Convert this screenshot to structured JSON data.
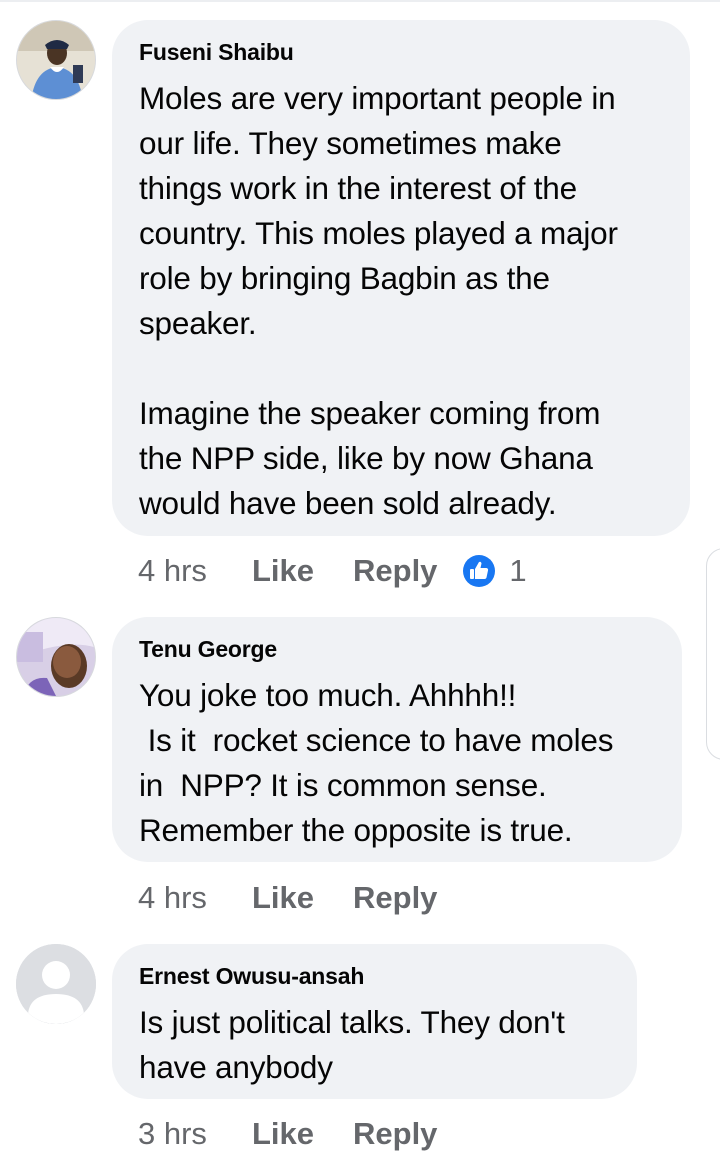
{
  "comments": [
    {
      "author": "Fuseni Shaibu",
      "text": "Moles are very important people in\nour life. They sometimes make\nthings work in the interest of the\ncountry. This moles played a major\nrole by bringing Bagbin as the\nspeaker.\n\nImagine the speaker coming from\nthe NPP side, like by now Ghana\nwould have been sold already.",
      "time": "4 hrs",
      "like": "Like",
      "reply": "Reply",
      "reaction_count": "1"
    },
    {
      "author": "Tenu George",
      "text": "You joke too much. Ahhhh!!\n Is it  rocket science to have moles\nin  NPP? It is common sense.\nRemember the opposite is true.",
      "time": "4 hrs",
      "like": "Like",
      "reply": "Reply"
    },
    {
      "author": "Ernest Owusu-ansah",
      "text": "Is just political talks. They don't\nhave anybody",
      "time": "3 hrs",
      "like": "Like",
      "reply": "Reply"
    }
  ],
  "colors": {
    "bubble": "#f0f2f5",
    "meta": "#65676b",
    "like_blue": "#1877f2"
  },
  "icons": [
    "like-reaction-icon",
    "default-avatar-icon"
  ]
}
